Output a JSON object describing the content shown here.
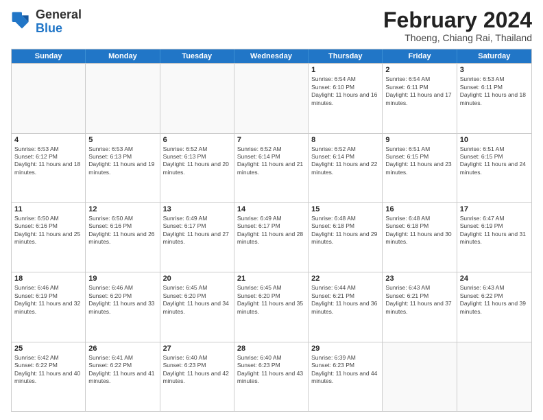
{
  "header": {
    "logo_general": "General",
    "logo_blue": "Blue",
    "month_title": "February 2024",
    "subtitle": "Thoeng, Chiang Rai, Thailand"
  },
  "weekdays": [
    "Sunday",
    "Monday",
    "Tuesday",
    "Wednesday",
    "Thursday",
    "Friday",
    "Saturday"
  ],
  "rows": [
    [
      {
        "day": "",
        "info": ""
      },
      {
        "day": "",
        "info": ""
      },
      {
        "day": "",
        "info": ""
      },
      {
        "day": "",
        "info": ""
      },
      {
        "day": "1",
        "info": "Sunrise: 6:54 AM\nSunset: 6:10 PM\nDaylight: 11 hours and 16 minutes."
      },
      {
        "day": "2",
        "info": "Sunrise: 6:54 AM\nSunset: 6:11 PM\nDaylight: 11 hours and 17 minutes."
      },
      {
        "day": "3",
        "info": "Sunrise: 6:53 AM\nSunset: 6:11 PM\nDaylight: 11 hours and 18 minutes."
      }
    ],
    [
      {
        "day": "4",
        "info": "Sunrise: 6:53 AM\nSunset: 6:12 PM\nDaylight: 11 hours and 18 minutes."
      },
      {
        "day": "5",
        "info": "Sunrise: 6:53 AM\nSunset: 6:13 PM\nDaylight: 11 hours and 19 minutes."
      },
      {
        "day": "6",
        "info": "Sunrise: 6:52 AM\nSunset: 6:13 PM\nDaylight: 11 hours and 20 minutes."
      },
      {
        "day": "7",
        "info": "Sunrise: 6:52 AM\nSunset: 6:14 PM\nDaylight: 11 hours and 21 minutes."
      },
      {
        "day": "8",
        "info": "Sunrise: 6:52 AM\nSunset: 6:14 PM\nDaylight: 11 hours and 22 minutes."
      },
      {
        "day": "9",
        "info": "Sunrise: 6:51 AM\nSunset: 6:15 PM\nDaylight: 11 hours and 23 minutes."
      },
      {
        "day": "10",
        "info": "Sunrise: 6:51 AM\nSunset: 6:15 PM\nDaylight: 11 hours and 24 minutes."
      }
    ],
    [
      {
        "day": "11",
        "info": "Sunrise: 6:50 AM\nSunset: 6:16 PM\nDaylight: 11 hours and 25 minutes."
      },
      {
        "day": "12",
        "info": "Sunrise: 6:50 AM\nSunset: 6:16 PM\nDaylight: 11 hours and 26 minutes."
      },
      {
        "day": "13",
        "info": "Sunrise: 6:49 AM\nSunset: 6:17 PM\nDaylight: 11 hours and 27 minutes."
      },
      {
        "day": "14",
        "info": "Sunrise: 6:49 AM\nSunset: 6:17 PM\nDaylight: 11 hours and 28 minutes."
      },
      {
        "day": "15",
        "info": "Sunrise: 6:48 AM\nSunset: 6:18 PM\nDaylight: 11 hours and 29 minutes."
      },
      {
        "day": "16",
        "info": "Sunrise: 6:48 AM\nSunset: 6:18 PM\nDaylight: 11 hours and 30 minutes."
      },
      {
        "day": "17",
        "info": "Sunrise: 6:47 AM\nSunset: 6:19 PM\nDaylight: 11 hours and 31 minutes."
      }
    ],
    [
      {
        "day": "18",
        "info": "Sunrise: 6:46 AM\nSunset: 6:19 PM\nDaylight: 11 hours and 32 minutes."
      },
      {
        "day": "19",
        "info": "Sunrise: 6:46 AM\nSunset: 6:20 PM\nDaylight: 11 hours and 33 minutes."
      },
      {
        "day": "20",
        "info": "Sunrise: 6:45 AM\nSunset: 6:20 PM\nDaylight: 11 hours and 34 minutes."
      },
      {
        "day": "21",
        "info": "Sunrise: 6:45 AM\nSunset: 6:20 PM\nDaylight: 11 hours and 35 minutes."
      },
      {
        "day": "22",
        "info": "Sunrise: 6:44 AM\nSunset: 6:21 PM\nDaylight: 11 hours and 36 minutes."
      },
      {
        "day": "23",
        "info": "Sunrise: 6:43 AM\nSunset: 6:21 PM\nDaylight: 11 hours and 37 minutes."
      },
      {
        "day": "24",
        "info": "Sunrise: 6:43 AM\nSunset: 6:22 PM\nDaylight: 11 hours and 39 minutes."
      }
    ],
    [
      {
        "day": "25",
        "info": "Sunrise: 6:42 AM\nSunset: 6:22 PM\nDaylight: 11 hours and 40 minutes."
      },
      {
        "day": "26",
        "info": "Sunrise: 6:41 AM\nSunset: 6:22 PM\nDaylight: 11 hours and 41 minutes."
      },
      {
        "day": "27",
        "info": "Sunrise: 6:40 AM\nSunset: 6:23 PM\nDaylight: 11 hours and 42 minutes."
      },
      {
        "day": "28",
        "info": "Sunrise: 6:40 AM\nSunset: 6:23 PM\nDaylight: 11 hours and 43 minutes."
      },
      {
        "day": "29",
        "info": "Sunrise: 6:39 AM\nSunset: 6:23 PM\nDaylight: 11 hours and 44 minutes."
      },
      {
        "day": "",
        "info": ""
      },
      {
        "day": "",
        "info": ""
      }
    ]
  ]
}
